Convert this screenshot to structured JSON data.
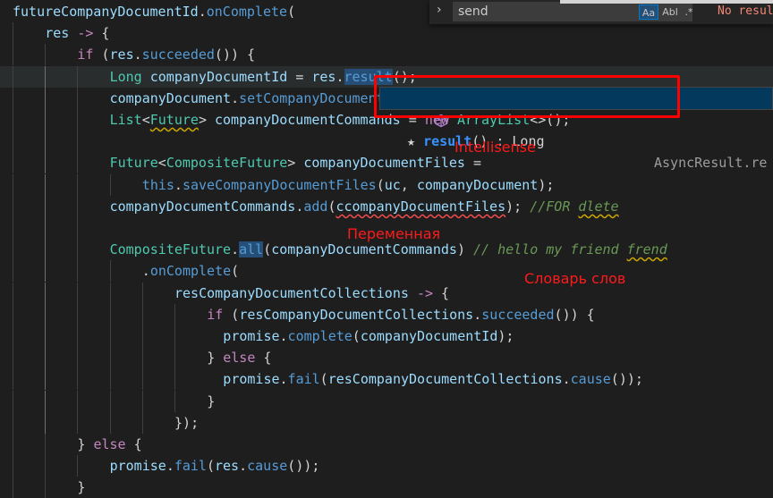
{
  "editor": {
    "lines": [
      {
        "text": "futureCompanyDocumentId.onComplete("
      },
      {
        "text": "res -> {"
      },
      {
        "text": "if (res.succeeded()) {"
      },
      {
        "text": "Long companyDocumentId = res.result();"
      },
      {
        "text": "companyDocument.setCompanyDocumentI"
      },
      {
        "text": "List<Future> companyDocumentCommands = new ArrayList<>();"
      },
      {
        "text": ""
      },
      {
        "text": "Future<CompositeFuture> companyDocumentFiles ="
      },
      {
        "text": "this.saveCompanyDocumentFiles(uc, companyDocument);"
      },
      {
        "text": "companyDocumentCommands.add(ccompanyDocumentFiles); //FOR dlete"
      },
      {
        "text": ""
      },
      {
        "text": "CompositeFuture.all(companyDocumentCommands) // hello my friend frend"
      },
      {
        "text": ".onComplete("
      },
      {
        "text": "resCompanyDocumentCollections -> {"
      },
      {
        "text": "if (resCompanyDocumentCollections.succeeded()) {"
      },
      {
        "text": "promise.complete(companyDocumentId);"
      },
      {
        "text": "} else {"
      },
      {
        "text": "promise.fail(resCompanyDocumentCollections.cause());"
      },
      {
        "text": "}"
      },
      {
        "text": "});"
      },
      {
        "text": "} else {"
      },
      {
        "text": "promise.fail(res.cause());"
      },
      {
        "text": "}"
      }
    ]
  },
  "find_widget": {
    "toggle_icon": "chevron-right-icon",
    "query": "send",
    "match_case_label": "Aa",
    "whole_word_label": "Abl",
    "regex_label": ".*",
    "result_text": "No results"
  },
  "suggest_widget": {
    "icon": "cube-icon",
    "star": "★",
    "match_text": "result",
    "label_rest": "() : Long",
    "detail": "AsyncResult.re"
  },
  "annotations": {
    "intellisense": "Intellisense",
    "variable": "Переменная",
    "dictionary": "Словарь слов"
  },
  "colors": {
    "background": "#1e1e1e",
    "keyword": "#c586c0",
    "type": "#4ec9b0",
    "function": "#dcdcaa",
    "variable": "#9cdcfe",
    "comment": "#6a9955",
    "annotation_red": "#ff0000",
    "suggest_match": "#3794ff"
  }
}
